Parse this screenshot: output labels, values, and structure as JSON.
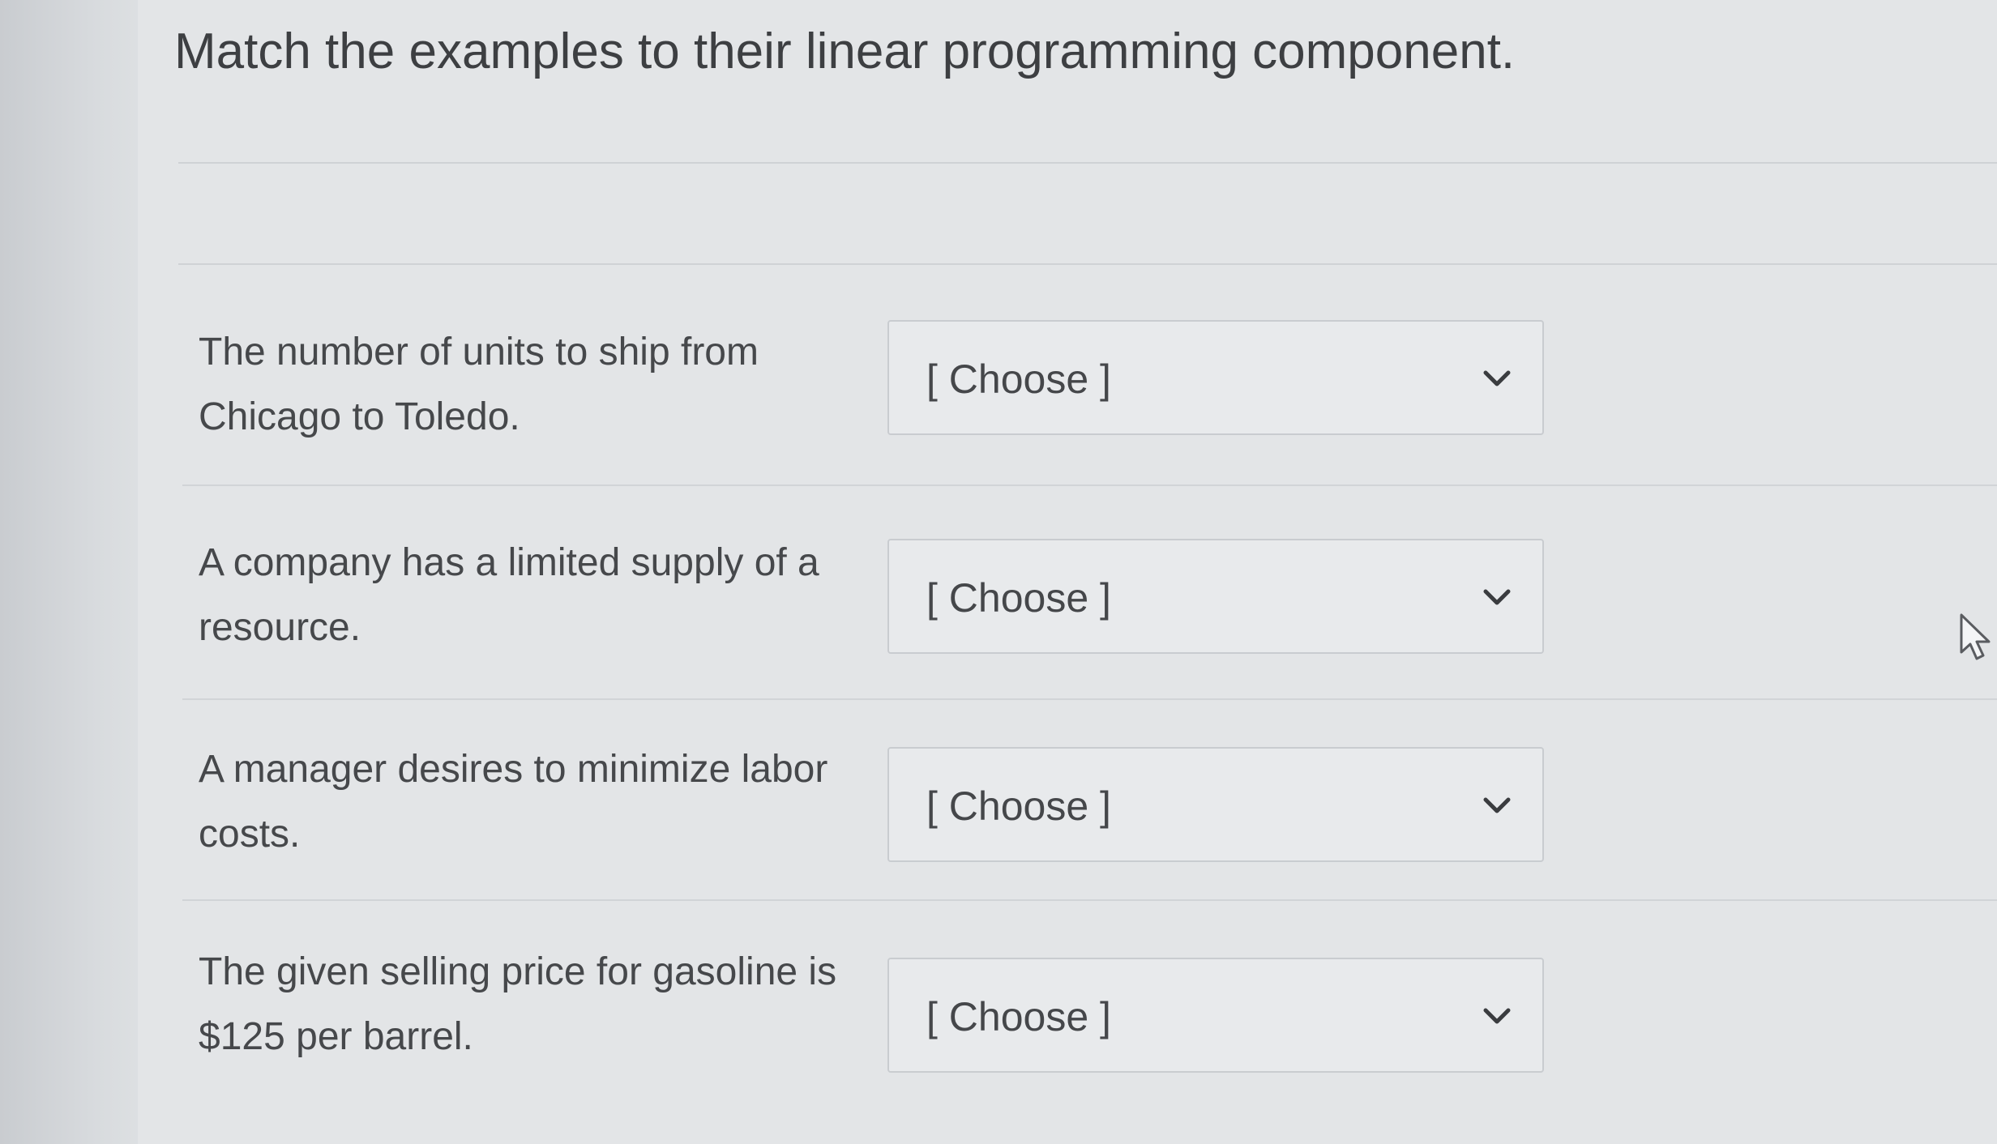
{
  "question": {
    "title": "Match the examples to their linear programming component."
  },
  "matches": [
    {
      "prompt_line1": "The number of units to ship from",
      "prompt_line2": "Chicago to Toledo.",
      "selected": "[ Choose ]",
      "icon": "chevron-down-icon"
    },
    {
      "prompt_line1": "A company has a limited supply of a",
      "prompt_line2": "resource.",
      "selected": "[ Choose ]",
      "icon": "chevron-down-icon"
    },
    {
      "prompt_line1": "A manager desires to minimize labor",
      "prompt_line2": "costs.",
      "selected": "[ Choose ]",
      "icon": "chevron-down-icon"
    },
    {
      "prompt_line1": "The given selling price for gasoline is",
      "prompt_line2": "$125 per barrel.",
      "selected": "[ Choose ]",
      "icon": "chevron-down-icon"
    }
  ],
  "pointer": {
    "icon": "mouse-pointer-icon"
  },
  "colors": {
    "text": "#3d3f42",
    "select_border": "#c9ccd0",
    "background": "#e3e5e7"
  }
}
